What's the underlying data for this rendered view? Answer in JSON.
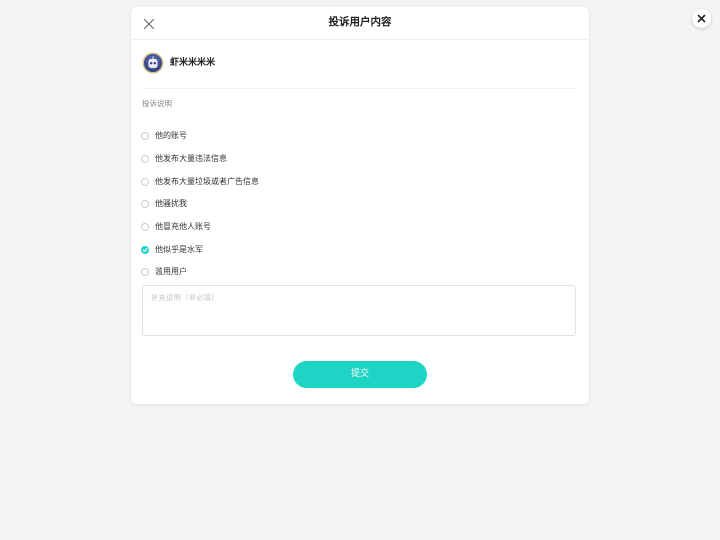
{
  "modal": {
    "title": "投诉用户内容"
  },
  "user": {
    "name": "虾米米米米",
    "avatar_icon": "robot-avatar"
  },
  "complaint": {
    "section_label": "投诉说明",
    "options": [
      {
        "label": "他的账号",
        "checked": false
      },
      {
        "label": "他发布大量违法信息",
        "checked": false
      },
      {
        "label": "他发布大量垃圾或者广告信息",
        "checked": false
      },
      {
        "label": "他骚扰我",
        "checked": false
      },
      {
        "label": "他冒充他人账号",
        "checked": false
      },
      {
        "label": "他似乎是水军",
        "checked": true
      },
      {
        "label": "滥用用户",
        "checked": false
      }
    ],
    "note_placeholder": "补充说明（非必填）",
    "note_value": ""
  },
  "actions": {
    "submit_label": "提交"
  },
  "colors": {
    "accent": "#1fd4c5",
    "background": "#f4f4f4"
  },
  "icons": {
    "page_close": "close-icon",
    "modal_close": "close-icon",
    "checked": "check-icon"
  }
}
